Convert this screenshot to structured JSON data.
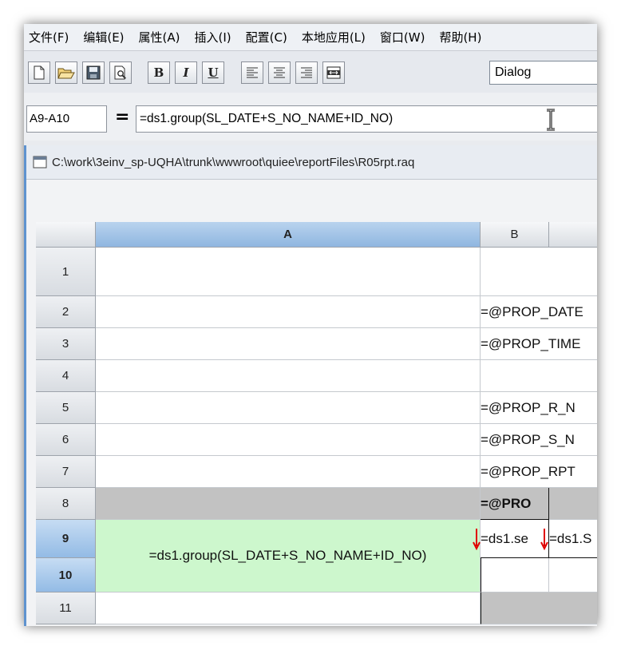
{
  "menu": {
    "items": [
      "文件(F)",
      "编辑(E)",
      "属性(A)",
      "插入(I)",
      "配置(C)",
      "本地应用(L)",
      "窗口(W)",
      "帮助(H)"
    ]
  },
  "toolbar": {
    "buttons": [
      "new-file-icon",
      "open-folder-icon",
      "save-icon",
      "print-preview-icon",
      "bold-icon",
      "italic-icon",
      "underline-icon",
      "align-left-icon",
      "align-center-icon",
      "align-right-icon",
      "merge-cells-icon"
    ],
    "bold_label": "B",
    "italic_label": "I",
    "underline_label": "U",
    "font_name": "Dialog"
  },
  "formula_bar": {
    "cell_ref": "A9-A10",
    "equals": "=",
    "expression": "=ds1.group(SL_DATE+S_NO_NAME+ID_NO)"
  },
  "document": {
    "path": "C:\\work\\3einv_sp-UQHA\\trunk\\wwwroot\\quiee\\reportFiles\\R05rpt.raq"
  },
  "grid": {
    "columns": [
      "A",
      "B"
    ],
    "rows": [
      "1",
      "2",
      "3",
      "4",
      "5",
      "6",
      "7",
      "8",
      "9",
      "10",
      "11"
    ],
    "selected_rows": [
      "9",
      "10"
    ],
    "cells": {
      "B2": "=@PROP_DATE",
      "B3": "=@PROP_TIME",
      "B5": "=@PROP_R_N",
      "B6": "=@PROP_S_N",
      "B7": "=@PROP_RPT",
      "B8": "=@PRO",
      "A9": "=ds1.group(SL_DATE+S_NO_NAME+ID_NO)",
      "B9": "=ds1.se",
      "C9": "=ds1.S"
    },
    "colors": {
      "merged_selected_cell": "#cdf7cd",
      "grey_row": "#c2c2c2",
      "expand_arrow": "#e00000",
      "tab_border": "#5f93cf"
    }
  }
}
